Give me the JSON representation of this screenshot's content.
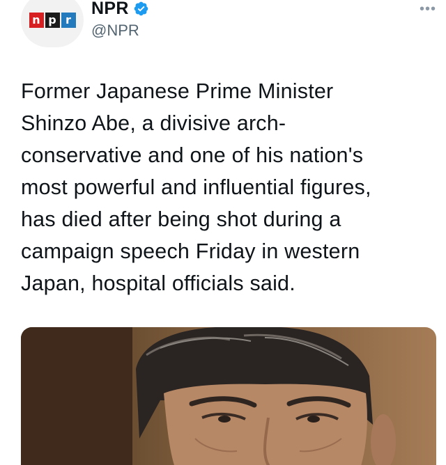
{
  "author": {
    "display_name": "NPR",
    "handle": "@NPR",
    "verified": true,
    "logo_letters": [
      "n",
      "p",
      "r"
    ]
  },
  "tweet": {
    "text": "Former Japanese Prime Minister\nShinzo Abe, a divisive arch-\nconservative and one of his nation's\nmost powerful and influential figures,\nhas died after being shot during a\ncampaign speech Friday in western\nJapan, hospital officials said."
  },
  "icons": {
    "verified": "verified-badge-icon",
    "more": "more-options-icon"
  },
  "colors": {
    "npr_red": "#d62021",
    "npr_black": "#1a1a1a",
    "npr_blue": "#237bbd",
    "verified_blue": "#1d9bf0",
    "handle_gray": "#536471"
  }
}
